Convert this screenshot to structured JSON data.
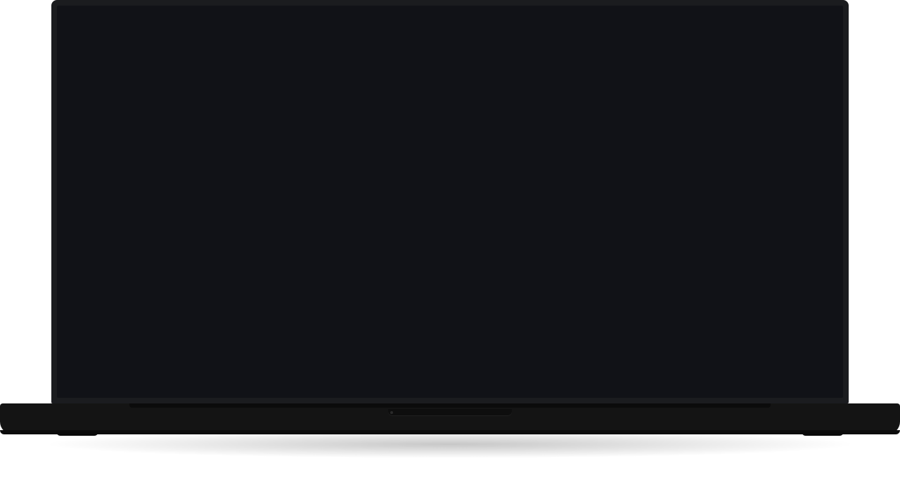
{
  "device": {
    "type": "laptop",
    "display_state": "off",
    "colors": {
      "background": "#ffffff",
      "bezel": "#1b1c1f",
      "screen": "#111217",
      "base": "#141414"
    }
  }
}
